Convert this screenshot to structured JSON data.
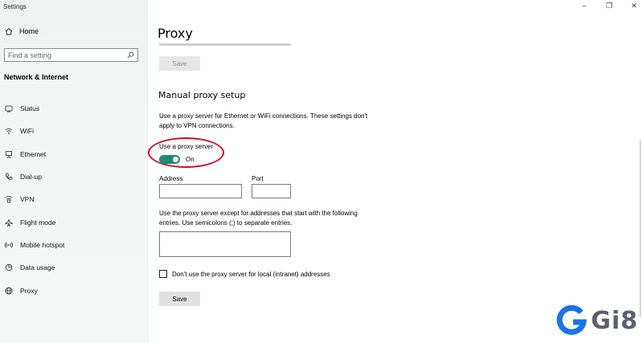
{
  "window": {
    "title": "Settings"
  },
  "sidebar": {
    "home_label": "Home",
    "search_placeholder": "Find a setting",
    "section_title": "Network & Internet",
    "items": [
      {
        "label": "Status",
        "icon": "globe-status-icon"
      },
      {
        "label": "WiFi",
        "icon": "wifi-icon"
      },
      {
        "label": "Ethernet",
        "icon": "ethernet-icon"
      },
      {
        "label": "Dial-up",
        "icon": "dial-up-icon"
      },
      {
        "label": "VPN",
        "icon": "vpn-icon"
      },
      {
        "label": "Flight mode",
        "icon": "airplane-icon"
      },
      {
        "label": "Mobile hotspot",
        "icon": "hotspot-icon"
      },
      {
        "label": "Data usage",
        "icon": "data-usage-icon"
      },
      {
        "label": "Proxy",
        "icon": "globe-icon"
      }
    ]
  },
  "main": {
    "page_title": "Proxy",
    "top_save_label": "Save",
    "manual_title": "Manual proxy setup",
    "manual_description": "Use a proxy server for Ethernet or WiFi connections. These settings don't apply to VPN connections.",
    "toggle": {
      "label": "Use a proxy server",
      "state_text": "On",
      "enabled": true
    },
    "address": {
      "label": "Address",
      "value": ""
    },
    "port": {
      "label": "Port",
      "value": ""
    },
    "exceptions_description": "Use the proxy server except for addresses that start with the following entries. Use semicolons (;) to separate entries.",
    "exceptions_value": "",
    "local_checkbox": {
      "label": "Don't use the proxy server for local (intranet) addresses",
      "checked": false
    },
    "bottom_save_label": "Save"
  },
  "watermark": {
    "text": "Gi8"
  },
  "colors": {
    "accent": "#1e8a6f",
    "annotation": "#c8102e",
    "logo_blue": "#1a73e8",
    "logo_text": "#5a6070"
  }
}
